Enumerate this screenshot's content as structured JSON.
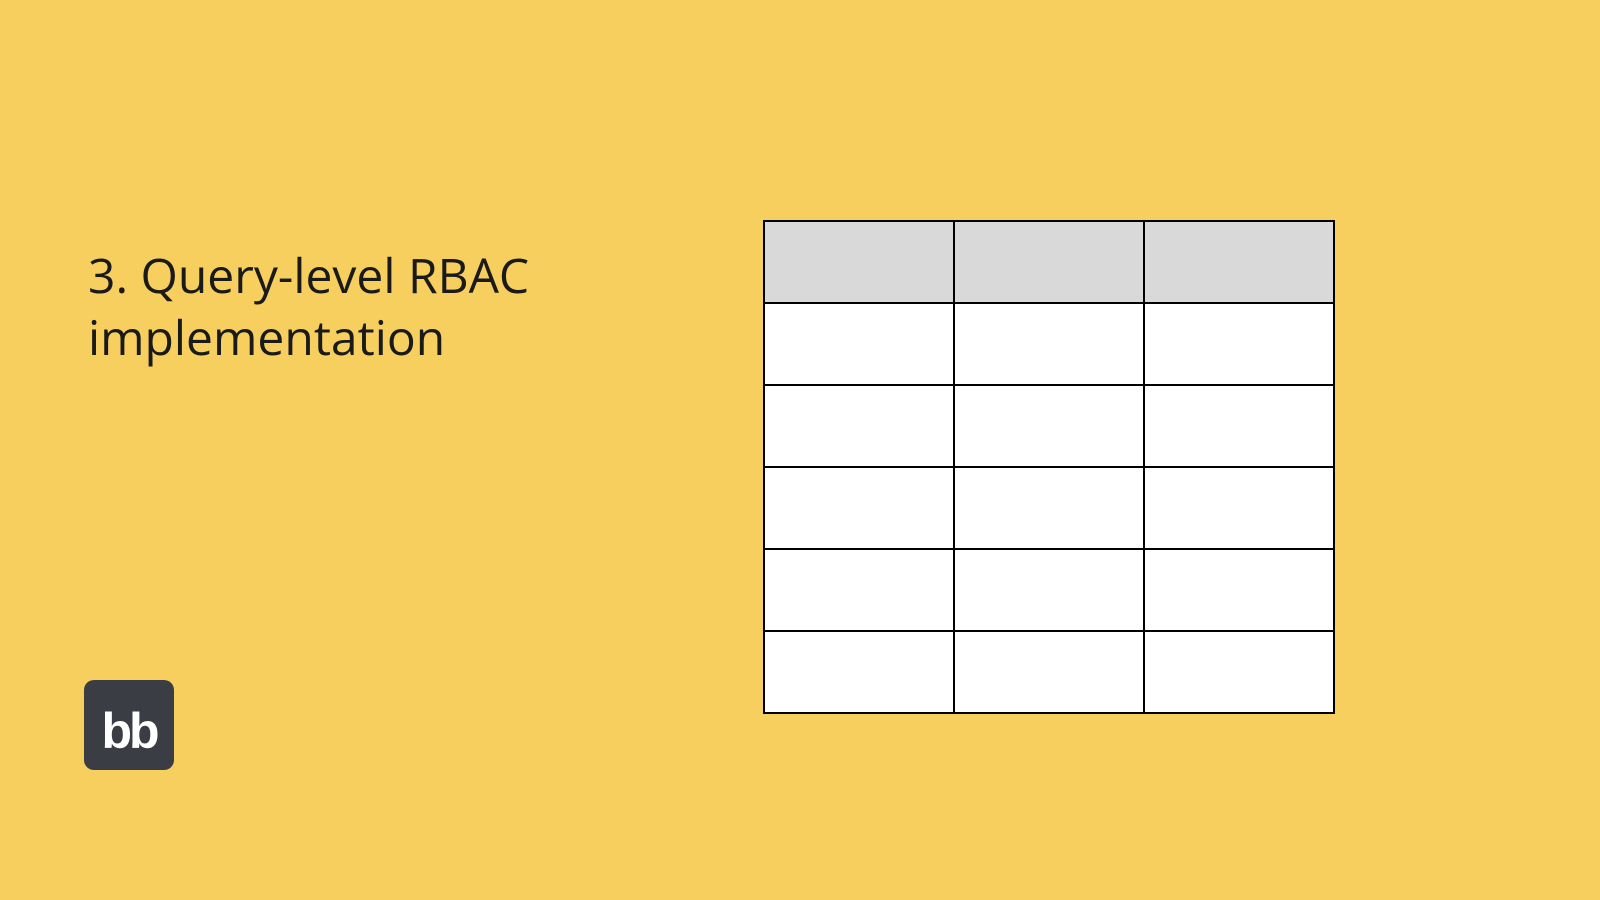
{
  "slide": {
    "title": "3. Query-level RBAC implementation"
  },
  "logo": {
    "text": "bb"
  },
  "table": {
    "columns": 3,
    "body_rows": 5,
    "headers": [
      "",
      "",
      ""
    ],
    "rows": [
      [
        "",
        "",
        ""
      ],
      [
        "",
        "",
        ""
      ],
      [
        "",
        "",
        ""
      ],
      [
        "",
        "",
        ""
      ],
      [
        "",
        "",
        ""
      ]
    ]
  },
  "colors": {
    "background": "#f7cf5f",
    "logo_bg": "#3a3d44",
    "logo_text": "#ffffff",
    "table_header_bg": "#d9d9d9",
    "table_cell_bg": "#ffffff",
    "table_border": "#000000",
    "text": "#1a1a1a"
  }
}
